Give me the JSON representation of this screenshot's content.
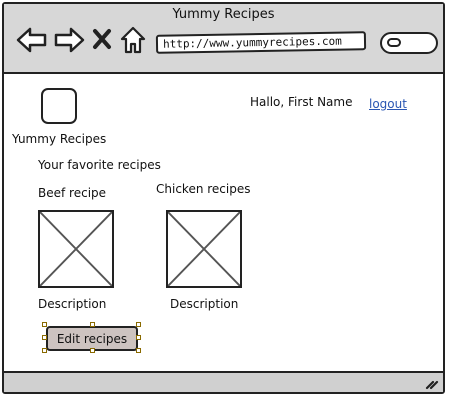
{
  "window": {
    "title": "Yummy Recipes",
    "url": "http://www.yummyrecipes.com"
  },
  "toolbar": {
    "icons": [
      "back-arrow-icon",
      "forward-arrow-icon",
      "close-x-icon",
      "home-icon",
      "search-icon"
    ]
  },
  "header": {
    "brand": "Yummy Recipes",
    "greeting": "Hallo, First Name",
    "logout_label": "logout"
  },
  "main": {
    "section_title": "Your favorite recipes",
    "recipes": [
      {
        "name": "Beef recipe",
        "description": "Description"
      },
      {
        "name": "Chicken recipes",
        "description": "Description"
      }
    ],
    "edit_button_label": "Edit recipes"
  },
  "colors": {
    "chrome": "#d7d7d7",
    "link": "#2a56b3",
    "button": "#cdc3c0"
  }
}
